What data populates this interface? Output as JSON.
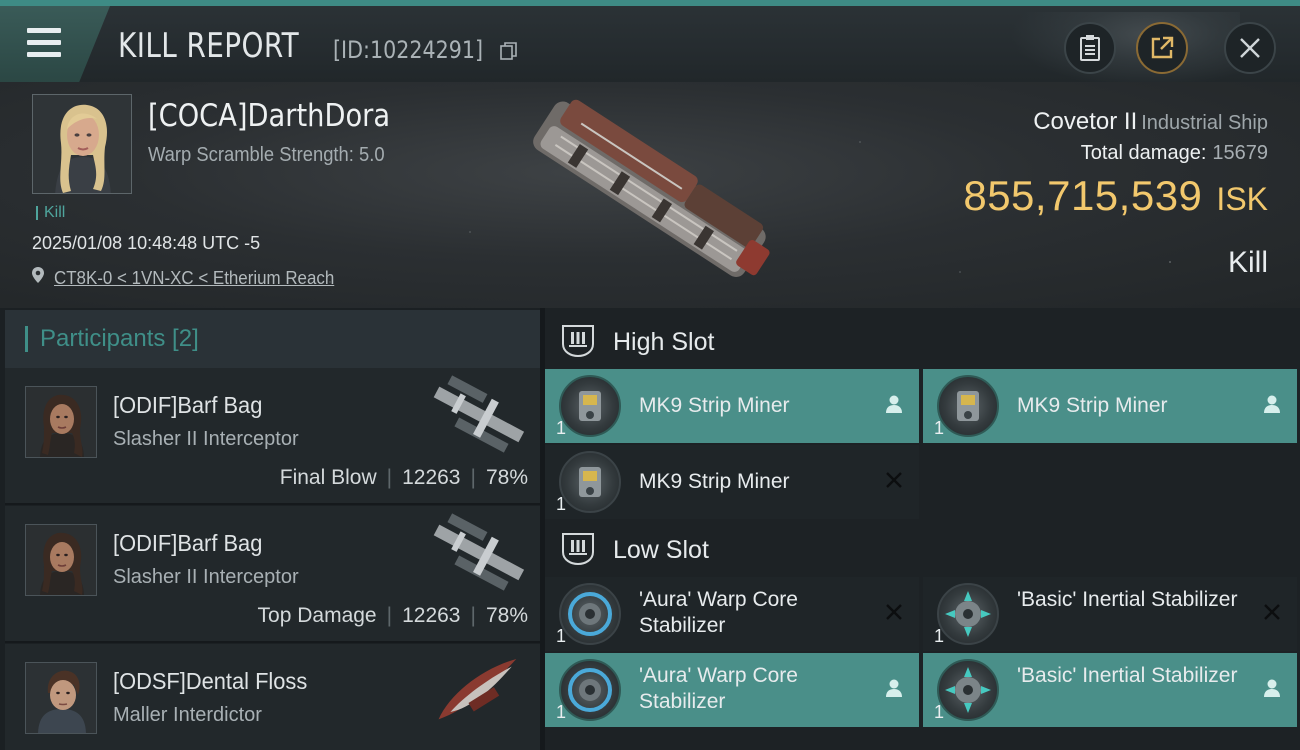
{
  "header": {
    "title": "KILL REPORT",
    "id_text": "[ID:10224291]"
  },
  "victim": {
    "name": "[COCA]DarthDora",
    "warp_scramble": "Warp Scramble Strength: 5.0",
    "tag": "Kill",
    "datetime": "2025/01/08 10:48:48 UTC -5",
    "location": "CT8K-0 < 1VN-XC < Etherium Reach",
    "ship_name": "Covetor II",
    "ship_class": "Industrial Ship",
    "total_damage_label": "Total damage:",
    "total_damage_value": "15679",
    "isk_value": "855,715,539",
    "isk_unit": "ISK",
    "result": "Kill"
  },
  "participants": {
    "title": "Participants [2]",
    "rows": [
      {
        "name": "[ODIF]Barf Bag",
        "ship": "Slasher II Interceptor",
        "label": "Final Blow",
        "damage": "12263",
        "percent": "78%"
      },
      {
        "name": "[ODIF]Barf Bag",
        "ship": "Slasher II Interceptor",
        "label": "Top Damage",
        "damage": "12263",
        "percent": "78%"
      },
      {
        "name": "[ODSF]Dental Floss",
        "ship": "Maller Interdictor",
        "badge": "i"
      }
    ]
  },
  "fittings": {
    "high_slot_label": "High Slot",
    "low_slot_label": "Low Slot",
    "high": [
      {
        "name": "MK9 Strip Miner",
        "qty": "1",
        "status": "dropped"
      },
      {
        "name": "MK9 Strip Miner",
        "qty": "1",
        "status": "dropped"
      },
      {
        "name": "MK9 Strip Miner",
        "qty": "1",
        "status": "destroyed"
      }
    ],
    "low": [
      {
        "name": "'Aura' Warp Core Stabilizer",
        "qty": "1",
        "status": "destroyed"
      },
      {
        "name": "'Basic' Inertial Stabilizer",
        "qty": "1",
        "status": "destroyed"
      },
      {
        "name": "'Aura' Warp Core Stabilizer",
        "qty": "1",
        "status": "dropped"
      },
      {
        "name": "'Basic' Inertial Stabilizer",
        "qty": "1",
        "status": "dropped"
      }
    ]
  },
  "colors": {
    "accent": "#3f8f88",
    "isk": "#f2c86d",
    "fitted_bg": "#4a8f89"
  }
}
